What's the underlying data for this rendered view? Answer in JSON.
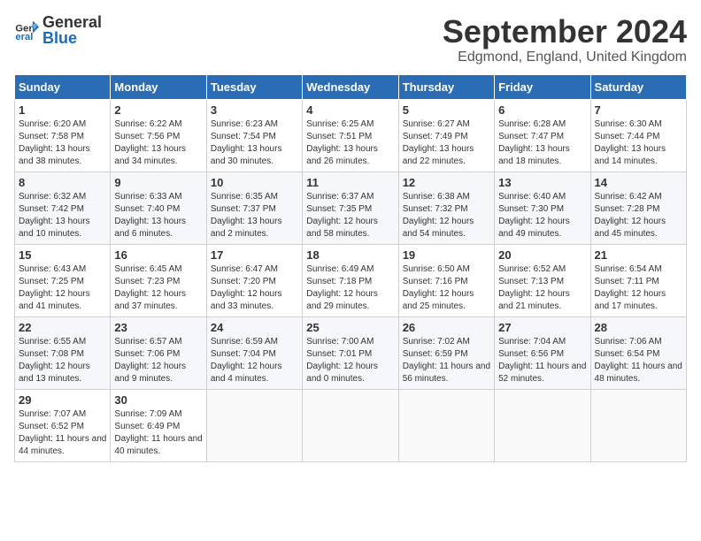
{
  "header": {
    "logo": {
      "general": "General",
      "blue": "Blue"
    },
    "title": "September 2024",
    "location": "Edgmond, England, United Kingdom"
  },
  "calendar": {
    "headers": [
      "Sunday",
      "Monday",
      "Tuesday",
      "Wednesday",
      "Thursday",
      "Friday",
      "Saturday"
    ],
    "weeks": [
      [
        {
          "day": "1",
          "sunrise": "6:20 AM",
          "sunset": "7:58 PM",
          "daylight": "13 hours and 38 minutes."
        },
        {
          "day": "2",
          "sunrise": "6:22 AM",
          "sunset": "7:56 PM",
          "daylight": "13 hours and 34 minutes."
        },
        {
          "day": "3",
          "sunrise": "6:23 AM",
          "sunset": "7:54 PM",
          "daylight": "13 hours and 30 minutes."
        },
        {
          "day": "4",
          "sunrise": "6:25 AM",
          "sunset": "7:51 PM",
          "daylight": "13 hours and 26 minutes."
        },
        {
          "day": "5",
          "sunrise": "6:27 AM",
          "sunset": "7:49 PM",
          "daylight": "13 hours and 22 minutes."
        },
        {
          "day": "6",
          "sunrise": "6:28 AM",
          "sunset": "7:47 PM",
          "daylight": "13 hours and 18 minutes."
        },
        {
          "day": "7",
          "sunrise": "6:30 AM",
          "sunset": "7:44 PM",
          "daylight": "13 hours and 14 minutes."
        }
      ],
      [
        {
          "day": "8",
          "sunrise": "6:32 AM",
          "sunset": "7:42 PM",
          "daylight": "13 hours and 10 minutes."
        },
        {
          "day": "9",
          "sunrise": "6:33 AM",
          "sunset": "7:40 PM",
          "daylight": "13 hours and 6 minutes."
        },
        {
          "day": "10",
          "sunrise": "6:35 AM",
          "sunset": "7:37 PM",
          "daylight": "13 hours and 2 minutes."
        },
        {
          "day": "11",
          "sunrise": "6:37 AM",
          "sunset": "7:35 PM",
          "daylight": "12 hours and 58 minutes."
        },
        {
          "day": "12",
          "sunrise": "6:38 AM",
          "sunset": "7:32 PM",
          "daylight": "12 hours and 54 minutes."
        },
        {
          "day": "13",
          "sunrise": "6:40 AM",
          "sunset": "7:30 PM",
          "daylight": "12 hours and 49 minutes."
        },
        {
          "day": "14",
          "sunrise": "6:42 AM",
          "sunset": "7:28 PM",
          "daylight": "12 hours and 45 minutes."
        }
      ],
      [
        {
          "day": "15",
          "sunrise": "6:43 AM",
          "sunset": "7:25 PM",
          "daylight": "12 hours and 41 minutes."
        },
        {
          "day": "16",
          "sunrise": "6:45 AM",
          "sunset": "7:23 PM",
          "daylight": "12 hours and 37 minutes."
        },
        {
          "day": "17",
          "sunrise": "6:47 AM",
          "sunset": "7:20 PM",
          "daylight": "12 hours and 33 minutes."
        },
        {
          "day": "18",
          "sunrise": "6:49 AM",
          "sunset": "7:18 PM",
          "daylight": "12 hours and 29 minutes."
        },
        {
          "day": "19",
          "sunrise": "6:50 AM",
          "sunset": "7:16 PM",
          "daylight": "12 hours and 25 minutes."
        },
        {
          "day": "20",
          "sunrise": "6:52 AM",
          "sunset": "7:13 PM",
          "daylight": "12 hours and 21 minutes."
        },
        {
          "day": "21",
          "sunrise": "6:54 AM",
          "sunset": "7:11 PM",
          "daylight": "12 hours and 17 minutes."
        }
      ],
      [
        {
          "day": "22",
          "sunrise": "6:55 AM",
          "sunset": "7:08 PM",
          "daylight": "12 hours and 13 minutes."
        },
        {
          "day": "23",
          "sunrise": "6:57 AM",
          "sunset": "7:06 PM",
          "daylight": "12 hours and 9 minutes."
        },
        {
          "day": "24",
          "sunrise": "6:59 AM",
          "sunset": "7:04 PM",
          "daylight": "12 hours and 4 minutes."
        },
        {
          "day": "25",
          "sunrise": "7:00 AM",
          "sunset": "7:01 PM",
          "daylight": "12 hours and 0 minutes."
        },
        {
          "day": "26",
          "sunrise": "7:02 AM",
          "sunset": "6:59 PM",
          "daylight": "11 hours and 56 minutes."
        },
        {
          "day": "27",
          "sunrise": "7:04 AM",
          "sunset": "6:56 PM",
          "daylight": "11 hours and 52 minutes."
        },
        {
          "day": "28",
          "sunrise": "7:06 AM",
          "sunset": "6:54 PM",
          "daylight": "11 hours and 48 minutes."
        }
      ],
      [
        {
          "day": "29",
          "sunrise": "7:07 AM",
          "sunset": "6:52 PM",
          "daylight": "11 hours and 44 minutes."
        },
        {
          "day": "30",
          "sunrise": "7:09 AM",
          "sunset": "6:49 PM",
          "daylight": "11 hours and 40 minutes."
        },
        null,
        null,
        null,
        null,
        null
      ]
    ]
  }
}
